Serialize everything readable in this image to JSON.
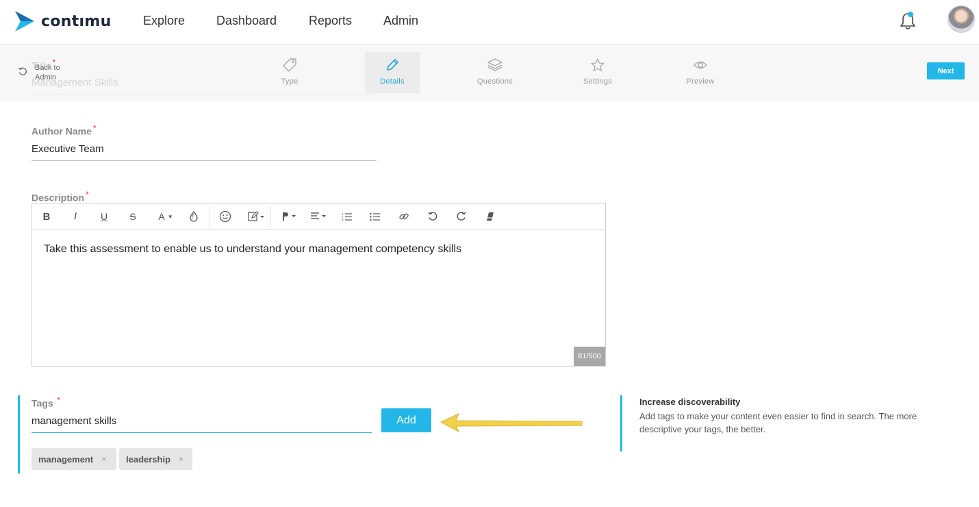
{
  "brand": {
    "name": "contımu",
    "accent_color": "#22b7e8"
  },
  "nav": {
    "items": [
      {
        "label": "Explore"
      },
      {
        "label": "Dashboard"
      },
      {
        "label": "Reports"
      },
      {
        "label": "Admin"
      }
    ],
    "notification_icon": "bell-icon",
    "avatar_icon": "user-avatar"
  },
  "background_form": {
    "title_label": "Title",
    "title_value": "Management Skills"
  },
  "stepbar": {
    "back_label": "Back to Admin",
    "steps": [
      {
        "label": "Type",
        "icon": "tag-icon"
      },
      {
        "label": "Details",
        "icon": "pencil-icon",
        "active": true
      },
      {
        "label": "Questions",
        "icon": "layers-icon"
      },
      {
        "label": "Settings",
        "icon": "star-icon"
      },
      {
        "label": "Preview",
        "icon": "eye-icon"
      }
    ],
    "next_label": "Next"
  },
  "form": {
    "author": {
      "label": "Author Name",
      "value": "Executive Team"
    },
    "description": {
      "label": "Description",
      "value": "Take this assessment to enable us to understand your management competency skills",
      "counter": "81/500",
      "toolbar": [
        "bold-icon",
        "italic-icon",
        "underline-icon",
        "strikethrough-icon",
        "font-color-icon",
        "highlight-icon",
        "emoji-icon",
        "insert-icon",
        "paragraph-format-icon",
        "align-icon",
        "ordered-list-icon",
        "unordered-list-icon",
        "link-icon",
        "undo-icon",
        "redo-icon",
        "clear-format-icon"
      ]
    },
    "tags": {
      "label": "Tags",
      "value": "management skills",
      "add_label": "Add",
      "chips": [
        {
          "label": "management"
        },
        {
          "label": "leadership"
        }
      ],
      "remove_glyph": "×"
    },
    "required_mark": "*"
  },
  "tip": {
    "title": "Increase discoverability",
    "text": "Add tags to make your content even easier to find in search. The more descriptive your tags, the better."
  }
}
